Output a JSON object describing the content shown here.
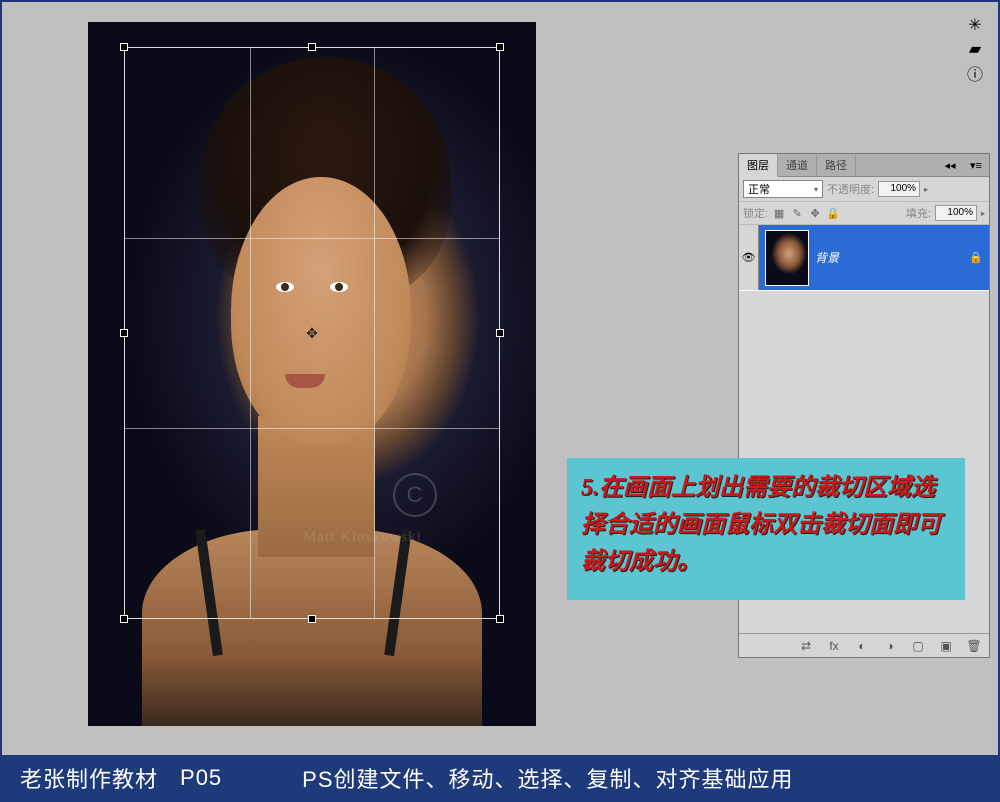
{
  "sidebar_tools": {
    "tool1": "settings-icon",
    "tool2": "gradient-icon",
    "tool3": "info-icon"
  },
  "watermark": {
    "symbol": "C",
    "text": "Matt Kloskowski"
  },
  "layers_panel": {
    "tabs": {
      "layers": "图层",
      "channels": "通道",
      "paths": "路径"
    },
    "blend_mode": "正常",
    "opacity_label": "不透明度:",
    "opacity_value": "100%",
    "lock_label": "锁定:",
    "fill_label": "填充:",
    "fill_value": "100%",
    "layer": {
      "name": "背景"
    }
  },
  "annotation": {
    "text": "5.在画面上划出需要的裁切区域选择合适的画面鼠标双击裁切面即可裁切成功。"
  },
  "footer": {
    "author": "老张制作教材",
    "page": "P05",
    "title": "PS创建文件、移动、选择、复制、对齐基础应用"
  },
  "crop_center_glyph": "✥"
}
